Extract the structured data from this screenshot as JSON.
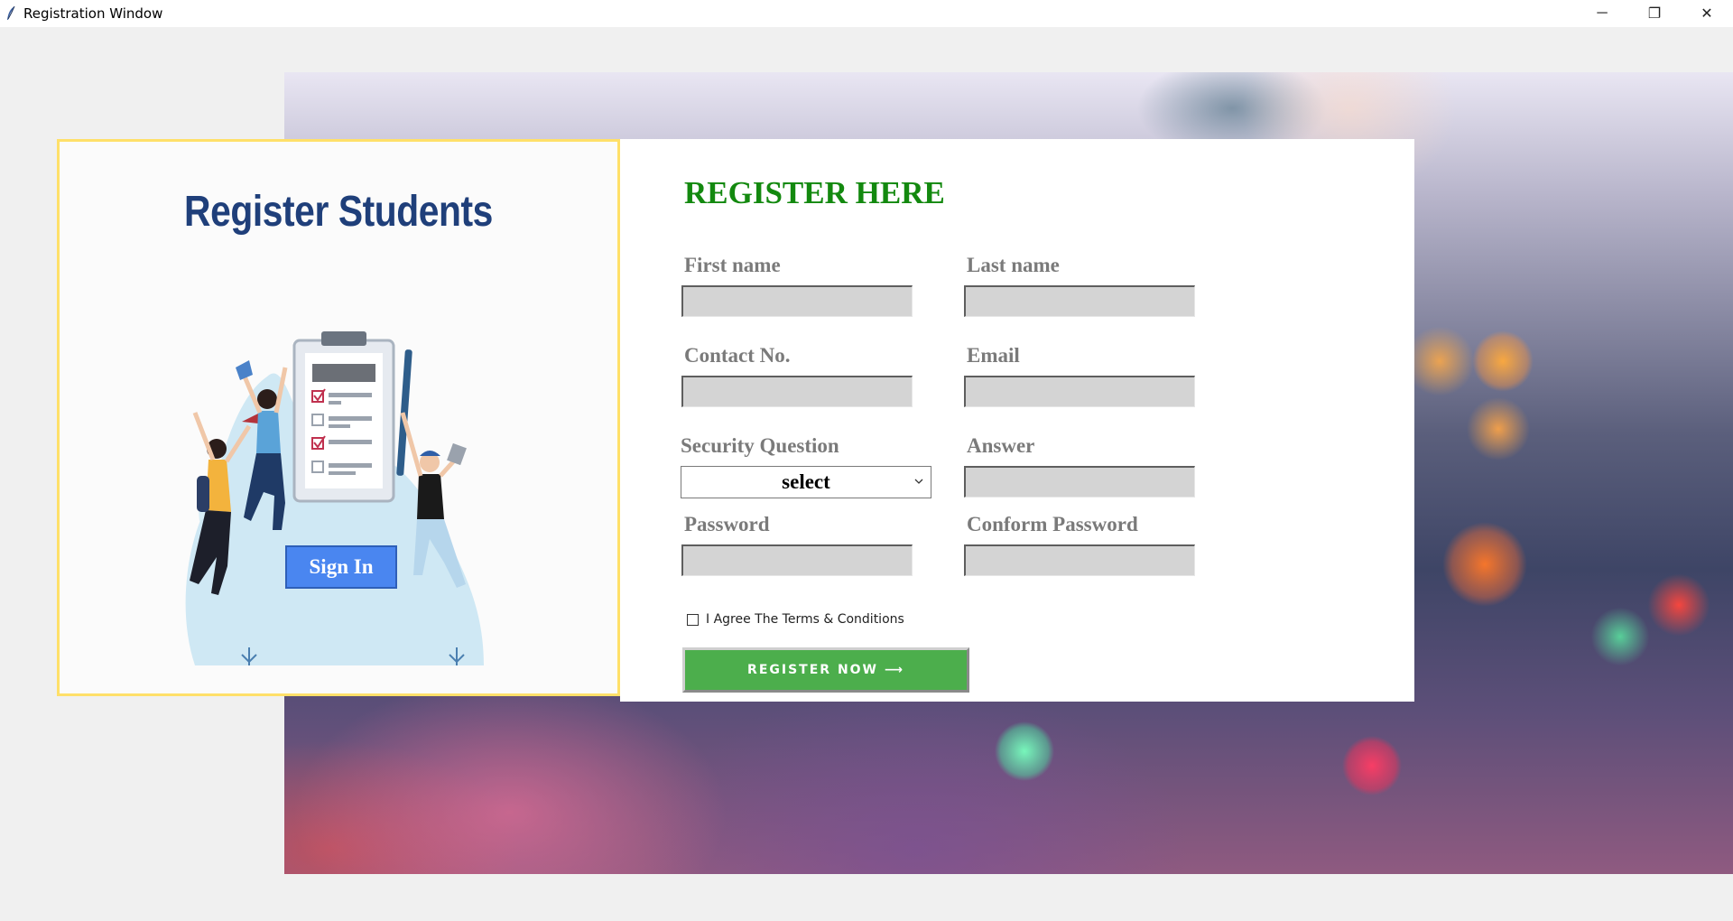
{
  "window": {
    "title": "Registration Window",
    "controls": {
      "minimize": "─",
      "restore": "❐",
      "close": "✕"
    }
  },
  "left_panel": {
    "title": "Register Students",
    "signin_label": "Sign In"
  },
  "form": {
    "heading": "REGISTER HERE",
    "fields": {
      "first_name": {
        "label": "First name",
        "value": ""
      },
      "last_name": {
        "label": "Last name",
        "value": ""
      },
      "contact": {
        "label": "Contact No.",
        "value": ""
      },
      "email": {
        "label": "Email",
        "value": ""
      },
      "security_question": {
        "label": "Security Question",
        "selected": "select"
      },
      "answer": {
        "label": "Answer",
        "value": ""
      },
      "password": {
        "label": "Password",
        "value": ""
      },
      "confirm_password": {
        "label": "Conform Password",
        "value": ""
      }
    },
    "terms_label": "I Agree The Terms & Conditions",
    "register_label": "REGISTER NOW ⟶"
  },
  "colors": {
    "heading_green": "#13890f",
    "label_gray": "#7a7a7a",
    "input_bg": "#d4d4d4",
    "register_green": "#4cae4c",
    "signin_blue": "#4a86f0",
    "card_border_yellow": "#ffe069",
    "brand_navy": "#1f3f7a"
  }
}
